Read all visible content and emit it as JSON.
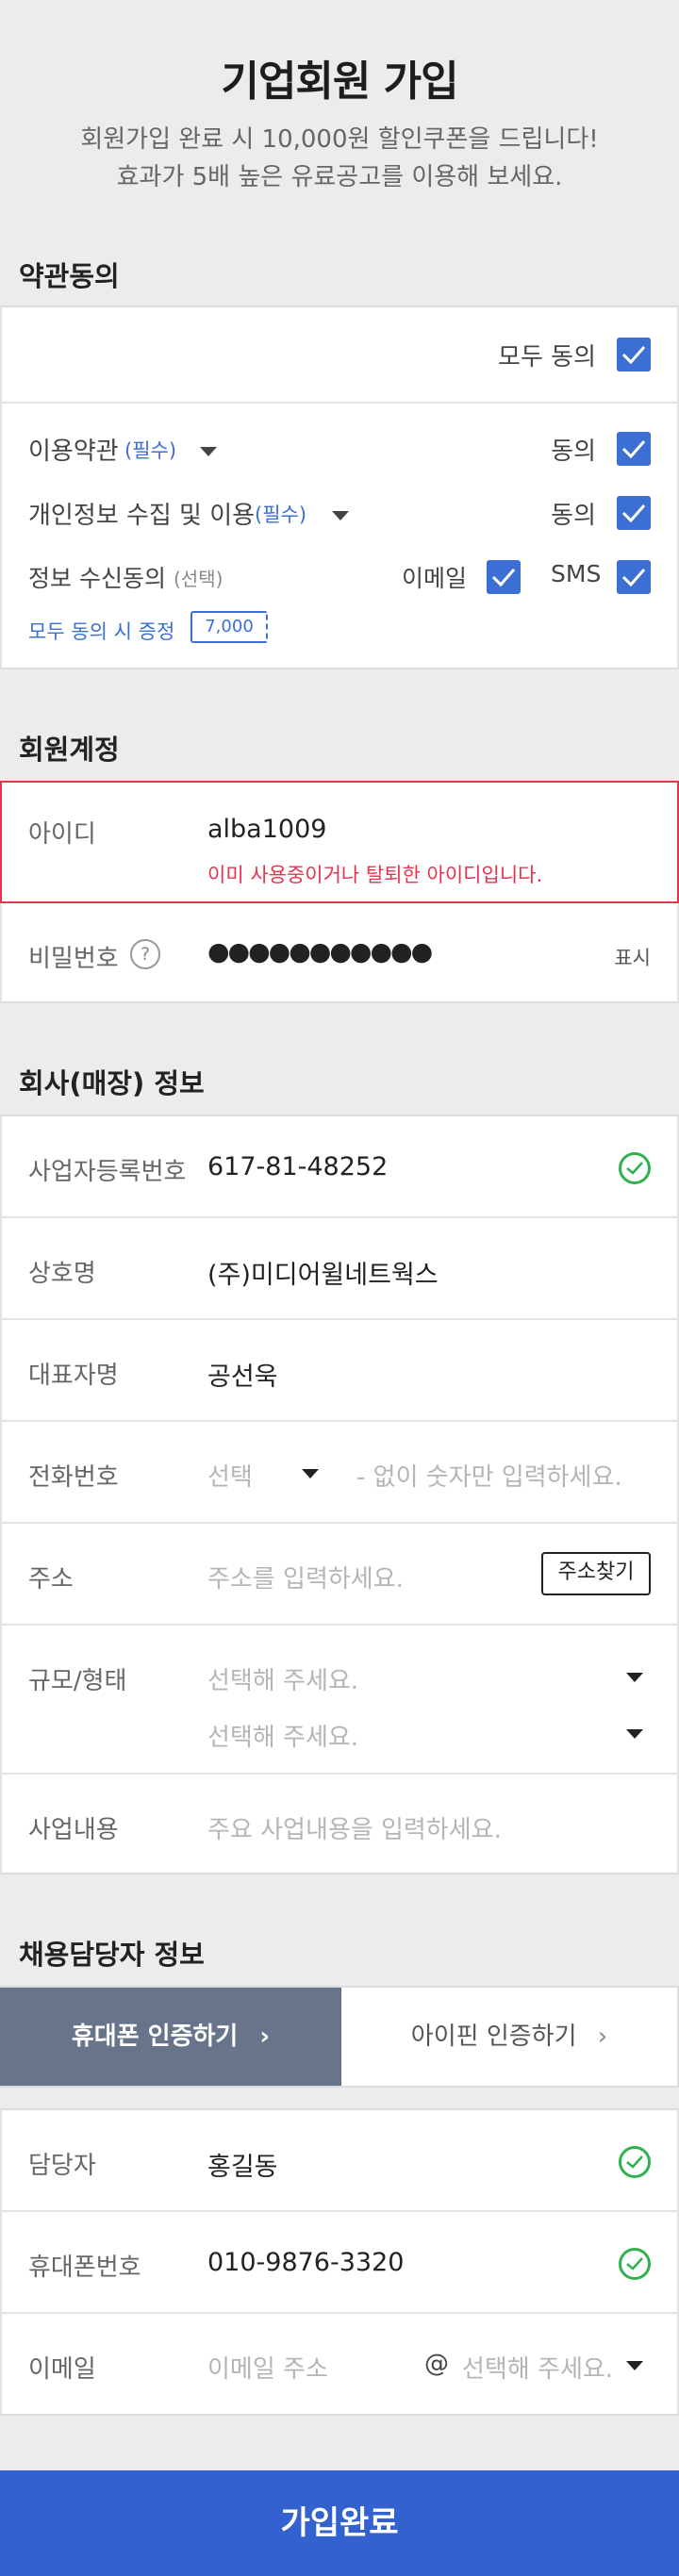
{
  "header": {
    "title": "기업회원 가입",
    "subtitle_line1": "회원가입 완료 시 10,000원 할인쿠폰을 드립니다!",
    "subtitle_line2": "효과가 5배 높은 유료공고를 이용해 보세요."
  },
  "terms": {
    "section_title": "약관동의",
    "agree_all_label": "모두 동의",
    "items": [
      {
        "label": "이용약관",
        "tag": "(필수)",
        "agree_label": "동의"
      },
      {
        "label": "개인정보 수집 및 이용",
        "tag": "(필수)",
        "agree_label": "동의"
      }
    ],
    "marketing": {
      "label": "정보 수신동의",
      "tag": "(선택)",
      "email_label": "이메일",
      "sms_label": "SMS",
      "promo_text": "모두 동의 시 증정",
      "coupon_value": "7,000"
    }
  },
  "account": {
    "section_title": "회원계정",
    "id_label": "아이디",
    "id_value": "alba1009",
    "id_error": "이미 사용중이거나 탈퇴한 아이디입니다.",
    "password_label": "비밀번호",
    "password_help": "?",
    "password_mask": "●●●●●●●●●●●",
    "show_label": "표시"
  },
  "company": {
    "section_title": "회사(매장) 정보",
    "biz_no_label": "사업자등록번호",
    "biz_no_value": "617-81-48252",
    "name_label": "상호명",
    "name_value": "(주)미디어윌네트웍스",
    "ceo_label": "대표자명",
    "ceo_value": "공선욱",
    "phone_label": "전화번호",
    "phone_select_placeholder": "선택",
    "phone_placeholder": "- 없이 숫자만 입력하세요.",
    "address_label": "주소",
    "address_placeholder": "주소를 입력하세요.",
    "address_button": "주소찾기",
    "scale_label": "규모/형태",
    "scale_placeholder_1": "선택해 주세요.",
    "scale_placeholder_2": "선택해 주세요.",
    "business_label": "사업내용",
    "business_placeholder": "주요 사업내용을 입력하세요."
  },
  "manager": {
    "section_title": "채용담당자 정보",
    "tab_phone": "휴대폰 인증하기",
    "tab_ipin": "아이핀 인증하기",
    "name_label": "담당자",
    "name_value": "홍길동",
    "mobile_label": "휴대폰번호",
    "mobile_value": "010-9876-3320",
    "email_label": "이메일",
    "email_placeholder": "이메일 주소",
    "email_at": "@",
    "email_domain_placeholder": "선택해 주세요."
  },
  "submit_label": "가입완료",
  "colors": {
    "accent": "#3361cf",
    "checkbox": "#3b6fd4",
    "error": "#e8334f",
    "ok": "#2fb24d",
    "active_tab": "#677489"
  }
}
